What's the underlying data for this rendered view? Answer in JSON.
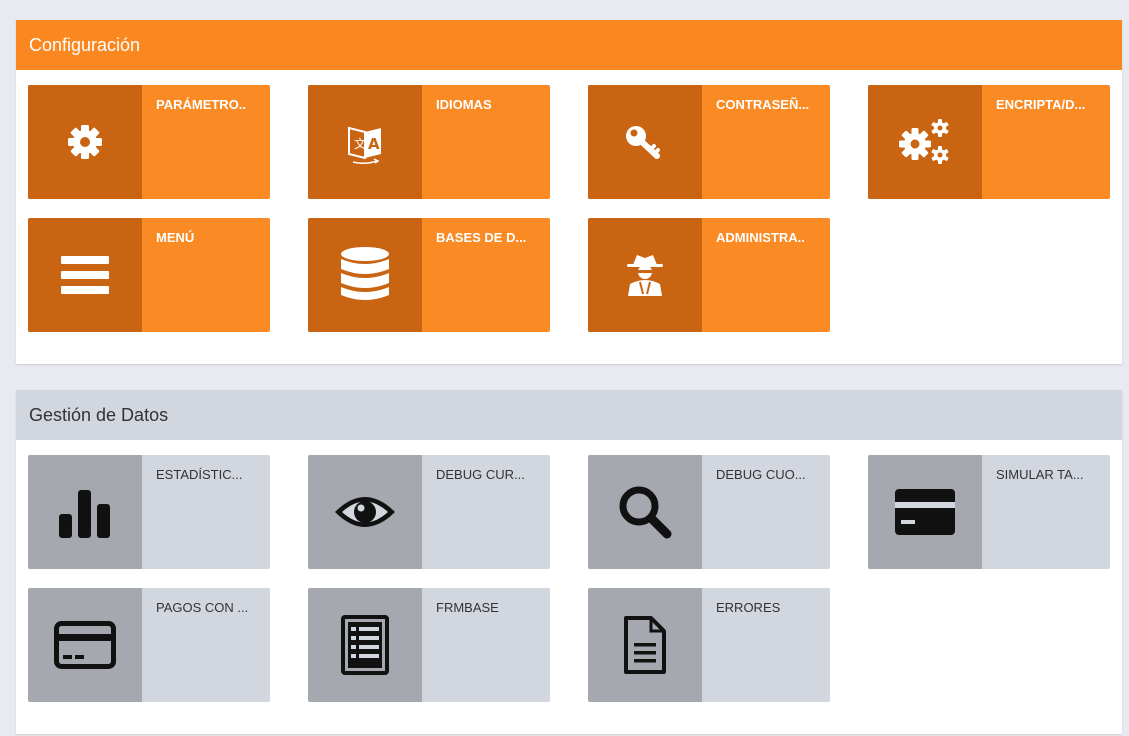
{
  "config": {
    "title": "Configuración",
    "tiles": [
      {
        "label": "PARÁMETRO..",
        "icon": "gear-icon"
      },
      {
        "label": "IDIOMAS",
        "icon": "translate-icon"
      },
      {
        "label": "CONTRASEÑ...",
        "icon": "key-icon"
      },
      {
        "label": "ENCRIPTA/D...",
        "icon": "gears-icon"
      },
      {
        "label": "MENÚ",
        "icon": "menu-icon"
      },
      {
        "label": "BASES DE D...",
        "icon": "database-icon"
      },
      {
        "label": "ADMINISTRA..",
        "icon": "user-secret-icon"
      }
    ]
  },
  "data_mgmt": {
    "title": "Gestión de Datos",
    "tiles": [
      {
        "label": "ESTADÍSTIC...",
        "icon": "bar-chart-icon"
      },
      {
        "label": "DEBUG CUR...",
        "icon": "eye-icon"
      },
      {
        "label": "DEBUG CUO...",
        "icon": "search-icon"
      },
      {
        "label": "SIMULAR TA...",
        "icon": "credit-card-icon"
      },
      {
        "label": "PAGOS CON ...",
        "icon": "credit-card-outline-icon"
      },
      {
        "label": "FRMBASE",
        "icon": "list-document-icon"
      },
      {
        "label": "ERRORES",
        "icon": "file-text-icon"
      }
    ]
  },
  "colors": {
    "orange": "#fa8a24",
    "orange_dark": "#c86412",
    "grey": "#d2d6df",
    "grey_dark": "#a5a8af"
  }
}
